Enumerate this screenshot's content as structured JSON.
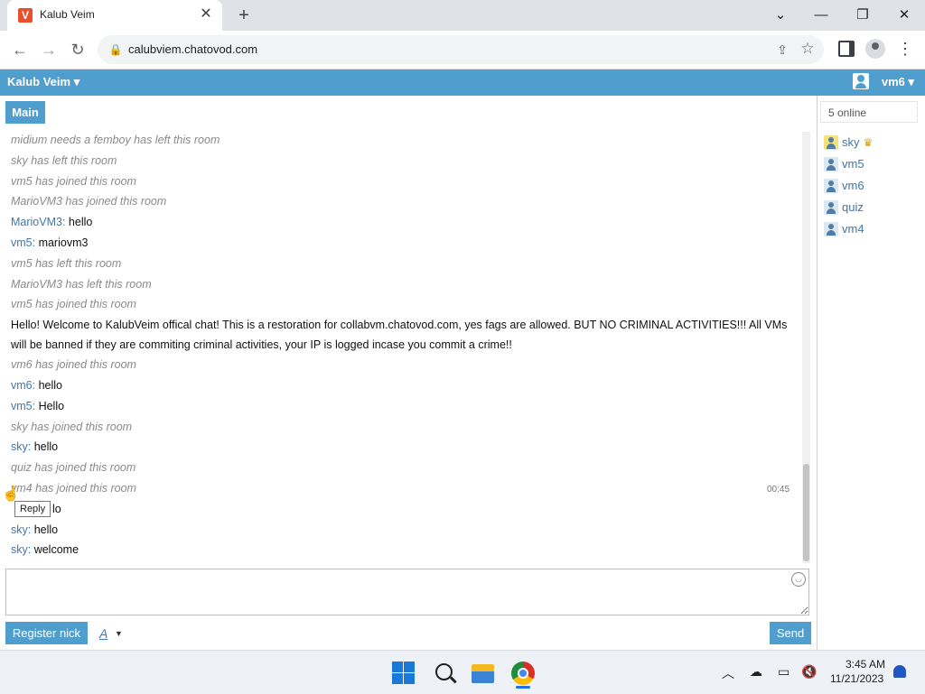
{
  "browser": {
    "tab_title": "Kalub Veim",
    "url": "calubviem.chatovod.com",
    "window_controls": {
      "minimize": "—",
      "restore": "❐",
      "close": "✕",
      "dropdown": "⌄"
    }
  },
  "header": {
    "room_owner": "Kalub Veim ▾",
    "current_user": "vm6 ▾"
  },
  "room_tab": "Main",
  "messages": [
    {
      "type": "system",
      "text": "midium needs a femboy has left this room"
    },
    {
      "type": "system",
      "text": "sky has left this room"
    },
    {
      "type": "system",
      "text": "vm5 has joined this room"
    },
    {
      "type": "system",
      "text": "MarioVM3 has joined this room"
    },
    {
      "type": "chat",
      "nick": "MarioVM3:",
      "text": " hello"
    },
    {
      "type": "chat",
      "nick": "vm5:",
      "text": " mariovm3"
    },
    {
      "type": "system",
      "text": "vm5 has left this room"
    },
    {
      "type": "system",
      "text": "MarioVM3 has left this room"
    },
    {
      "type": "system",
      "text": "vm5 has joined this room"
    },
    {
      "type": "announcement",
      "text": "Hello! Welcome to KalubVeim offical chat! This is a restoration for collabvm.chatovod.com, yes fags are allowed. BUT NO CRIMINAL ACTIVITIES!!! All VMs will be banned if they are commiting criminal activities, your IP is logged incase you commit a crime!!"
    },
    {
      "type": "system",
      "text": "vm6 has joined this room"
    },
    {
      "type": "chat",
      "nick": "vm6:",
      "text": " hello"
    },
    {
      "type": "chat",
      "nick": "vm5:",
      "text": " Hello"
    },
    {
      "type": "system",
      "text": "sky has joined this room"
    },
    {
      "type": "chat",
      "nick": "sky:",
      "text": " hello"
    },
    {
      "type": "system",
      "text": "quiz has joined this room"
    },
    {
      "type": "system",
      "text": "vm4 has joined this room"
    },
    {
      "type": "chat",
      "nick": "",
      "text": "lo"
    },
    {
      "type": "chat",
      "nick": "sky:",
      "text": " hello"
    },
    {
      "type": "chat",
      "nick": "sky:",
      "text": " welcome"
    }
  ],
  "hover_time": "00:45",
  "reply_tooltip": "Reply",
  "online_count": "5 online",
  "users": [
    {
      "name": "sky",
      "crown": true
    },
    {
      "name": "vm5",
      "crown": false
    },
    {
      "name": "vm6",
      "crown": false
    },
    {
      "name": "quiz",
      "crown": false
    },
    {
      "name": "vm4",
      "crown": false
    }
  ],
  "input": {
    "placeholder": ""
  },
  "buttons": {
    "register": "Register nick",
    "font_style": "A",
    "send": "Send"
  },
  "taskbar": {
    "time": "3:45 AM",
    "date": "11/21/2023"
  },
  "colors": {
    "accent": "#4f9ece",
    "nick": "#3f77a8",
    "system_text": "#8a8a8a"
  }
}
